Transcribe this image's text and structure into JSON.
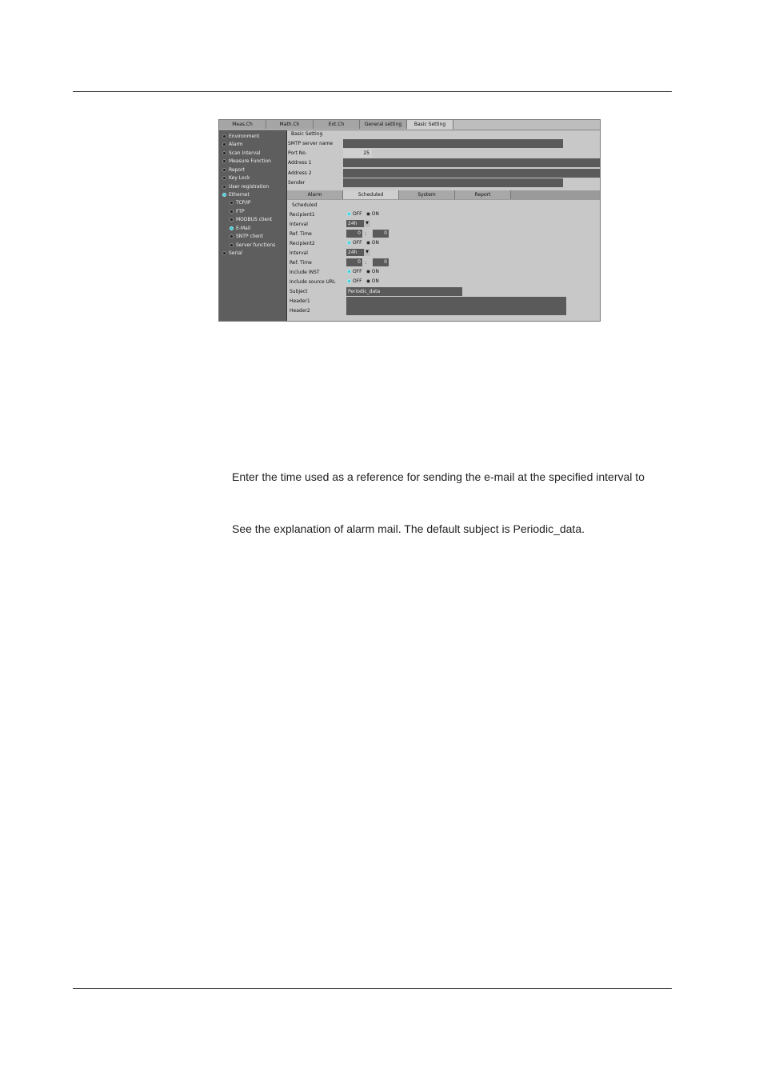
{
  "tabs": [
    "Meas.Ch",
    "Math.Ch",
    "Ext.Ch",
    "General setting",
    "Basic Setting"
  ],
  "sidebar": {
    "items": [
      {
        "label": "Environment",
        "on": false
      },
      {
        "label": "Alarm",
        "on": false
      },
      {
        "label": "Scan Interval",
        "on": false
      },
      {
        "label": "Measure Function",
        "on": false
      },
      {
        "label": "Report",
        "on": false
      },
      {
        "label": "Key Lock",
        "on": false
      },
      {
        "label": "User registration",
        "on": false
      },
      {
        "label": "Ethernet",
        "on": true
      },
      {
        "label": "TCP/IP",
        "on": false
      },
      {
        "label": "FTP",
        "on": false
      },
      {
        "label": "MODBUS client",
        "on": false
      },
      {
        "label": "E-Mail",
        "on": true
      },
      {
        "label": "SNTP client",
        "on": false
      },
      {
        "label": "Server functions",
        "on": false
      },
      {
        "label": "Serial",
        "on": false
      }
    ]
  },
  "basic": {
    "group_title": "Basic Setting",
    "smtp_label": "SMTP server name",
    "port_label": "Port No.",
    "port_value": "25",
    "address1_label": "Address 1",
    "address2_label": "Address 2",
    "sender_label": "Sender"
  },
  "subtabs": [
    "Alarm",
    "Scheduled",
    "System",
    "Report"
  ],
  "scheduled": {
    "group_title": "Scheduled",
    "recipient1_label": "Recipient1",
    "interval1_label": "Interval",
    "interval1_value": "24h",
    "reftime1_label": "Ref. Time",
    "reftime1_h": "0",
    "reftime1_m": "0",
    "recipient2_label": "Recipient2",
    "interval2_label": "Interval",
    "interval2_value": "24h",
    "reftime2_label": "Ref. Time",
    "reftime2_h": "0",
    "reftime2_m": "0",
    "include_inst_label": "Include INST",
    "include_url_label": "Include source URL",
    "subject_label": "Subject",
    "subject_value": "Periodic_data",
    "header1_label": "Header1",
    "header2_label": "Header2",
    "off_label": "OFF",
    "on_label": "ON",
    "time_sep": ":"
  },
  "body_text": {
    "para1": "Enter the time used as a reference for sending the e-mail at the specified interval to",
    "para2": "See the explanation of alarm mail. The default subject is Periodic_data."
  }
}
